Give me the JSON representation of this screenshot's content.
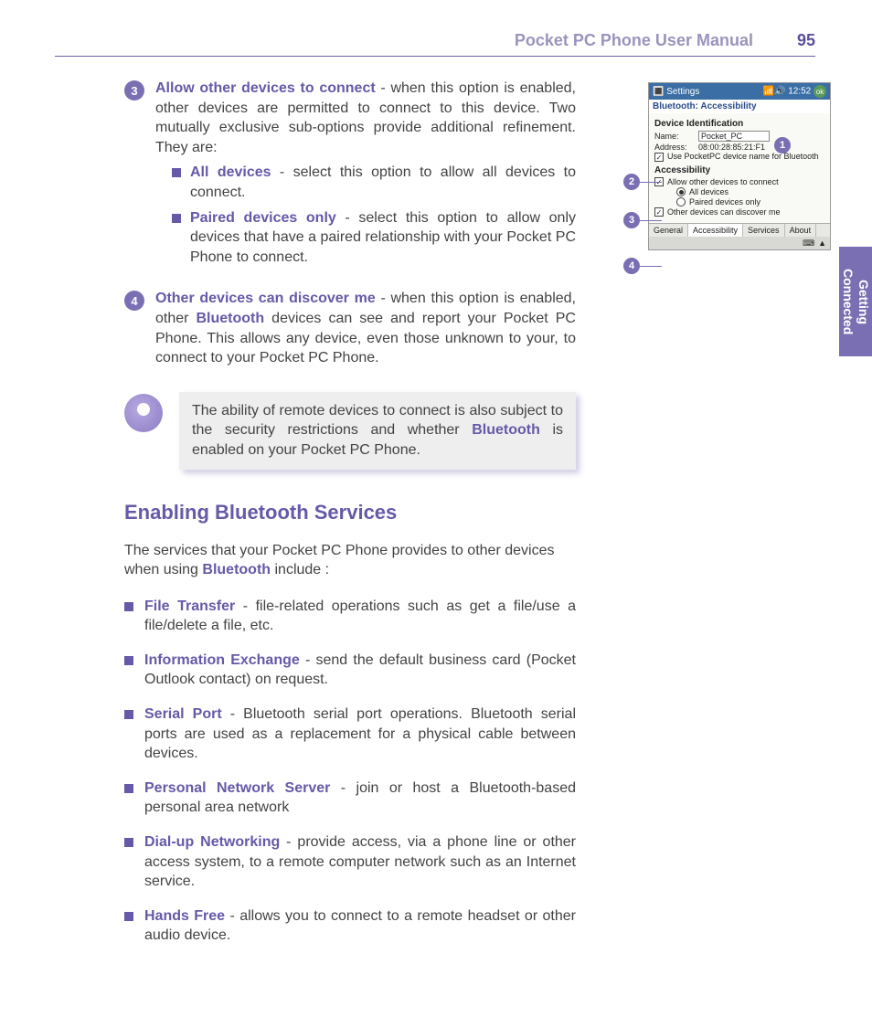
{
  "header": {
    "title": "Pocket PC Phone User Manual",
    "page": "95"
  },
  "sidebar": {
    "label": "Getting\nConnected"
  },
  "step3": {
    "num": "3",
    "title": "Allow other devices to connect",
    "body": " - when this option is enabled, other devices are permitted to connect to this device. Two mutually exclusive sub-options provide additional refinement. They are:",
    "sub": [
      {
        "title": "All devices",
        "body": " - select this option to allow all devices to connect."
      },
      {
        "title": "Paired devices only",
        "body": " - select this option to allow only devices that have a paired relationship with your Pocket PC Phone to connect."
      }
    ]
  },
  "step4": {
    "num": "4",
    "title": "Other devices can discover me",
    "body1": " - when this option is enabled, other ",
    "bt": "Bluetooth",
    "body2": " devices can see and report your Pocket PC Phone. This allows any device, even those unknown to your, to connect to your Pocket PC Phone."
  },
  "tip": {
    "part1": "The ability of remote devices to connect is also subject to the security restrictions and whether ",
    "bt": "Bluetooth",
    "part2": " is enabled on your Pocket PC Phone."
  },
  "section": {
    "title": "Enabling Bluetooth Services"
  },
  "intro": {
    "part1": "The services that your Pocket PC Phone provides to other devices when using ",
    "bt": "Bluetooth",
    "part2": " include :"
  },
  "services": [
    {
      "title": "File Transfer",
      "body": " - file-related operations such as get a file/use a file/delete a file, etc."
    },
    {
      "title": "Information Exchange",
      "body": " - send the default business card (Pocket Outlook contact) on request."
    },
    {
      "title": "Serial Port",
      "body": " - Bluetooth serial port operations. Bluetooth serial ports are used as a replacement for a physical cable between devices."
    },
    {
      "title": "Personal Network Server",
      "body": " - join or host a Bluetooth-based personal area network"
    },
    {
      "title": "Dial-up Networking",
      "body": " - provide access, via a phone line or other access system, to a remote computer network such as an Internet service."
    },
    {
      "title": "Hands Free",
      "body": " - allows you to connect to a remote headset or other audio device."
    }
  ],
  "screenshot": {
    "title": "Settings",
    "time": "12:52",
    "ok": "ok",
    "subtitle": "Bluetooth: Accessibility",
    "sect1": "Device Identification",
    "name_label": "Name:",
    "name_value": "Pocket_PC",
    "addr_label": "Address:",
    "addr_value": "08:00:28:85:21:F1",
    "opt_usename": "Use PocketPC device name for Bluetooth",
    "sect2": "Accessibility",
    "opt_allow": "Allow other devices to connect",
    "opt_all": "All devices",
    "opt_paired": "Paired devices only",
    "opt_discover": "Other devices can discover me",
    "tabs": [
      "General",
      "Accessibility",
      "Services",
      "About"
    ],
    "callouts": [
      "1",
      "2",
      "3",
      "4"
    ]
  }
}
